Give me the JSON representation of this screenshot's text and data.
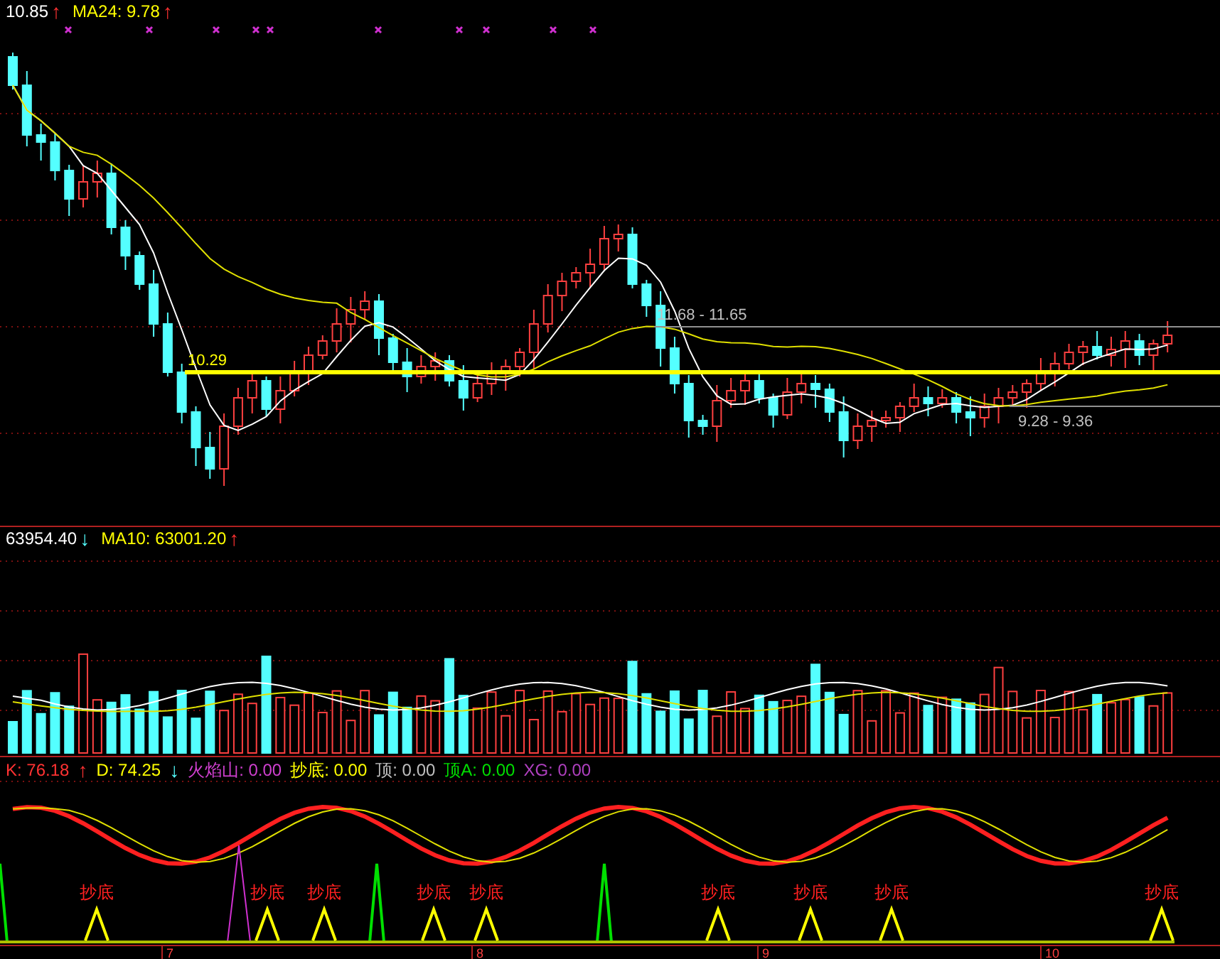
{
  "price_header": [
    {
      "text": "10.85",
      "color": "#ffffff"
    },
    {
      "text": "↑",
      "color": "#ff3232"
    },
    {
      "text": "MA24: 9.78",
      "color": "#ffff00"
    },
    {
      "text": "↑",
      "color": "#ff3232"
    }
  ],
  "price_labels": [
    {
      "text": "10.29",
      "color": "#ffff00"
    },
    {
      "text": "11.68 - 11.65",
      "color": "#c0c0c0"
    },
    {
      "text": "9.28 - 9.36",
      "color": "#c0c0c0"
    }
  ],
  "volume_header": [
    {
      "text": "63954.40",
      "color": "#ffffff"
    },
    {
      "text": "↓",
      "color": "#54ffff"
    },
    {
      "text": "MA10: 63001.20",
      "color": "#ffff00"
    },
    {
      "text": "↑",
      "color": "#ff3232"
    }
  ],
  "indicator_header": [
    {
      "text": "K: 76.18",
      "color": "#ff3232"
    },
    {
      "text": "↑",
      "color": "#ff3232"
    },
    {
      "text": "D: 74.25",
      "color": "#ffff00"
    },
    {
      "text": "↓",
      "color": "#54ffff"
    },
    {
      "text": "火焰山: 0.00",
      "color": "#d040d0"
    },
    {
      "text": "抄底: 0.00",
      "color": "#ffff00"
    },
    {
      "text": "顶: 0.00",
      "color": "#c0c0c0"
    },
    {
      "text": "顶A: 0.00",
      "color": "#00e000"
    },
    {
      "text": "XG: 0.00",
      "color": "#b040c0"
    }
  ],
  "signals": [
    {
      "label": "抄底"
    },
    {
      "label": "抄底"
    },
    {
      "label": "抄底"
    },
    {
      "label": "抄底"
    },
    {
      "label": "抄底"
    },
    {
      "label": "抄底"
    },
    {
      "label": "抄底"
    },
    {
      "label": "抄底"
    },
    {
      "label": "抄底"
    }
  ],
  "x_axis": [
    "7",
    "8",
    "9",
    "10"
  ]
}
